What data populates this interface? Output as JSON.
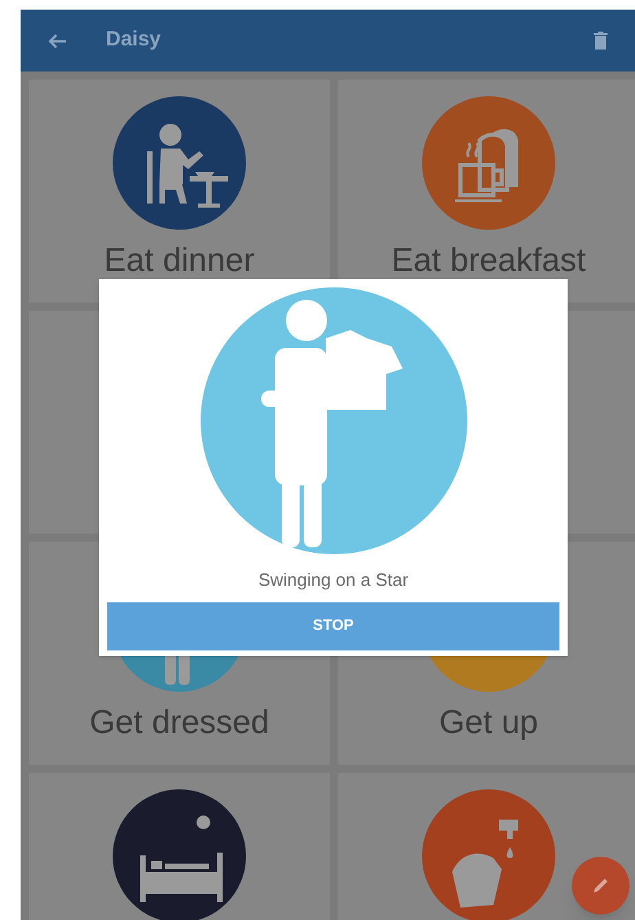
{
  "app_bar": {
    "title": "Daisy"
  },
  "tiles": [
    {
      "label": "Eat dinner",
      "color": "#1b3a63",
      "kind": "dining"
    },
    {
      "label": "Eat breakfast",
      "color": "#a14d1f",
      "kind": "breakfast"
    },
    {
      "kind": "blank"
    },
    {
      "kind": "blank"
    },
    {
      "label": "Get dressed",
      "color": "#3a8aa6",
      "kind": "dressing"
    },
    {
      "label": "Get up",
      "color": "#b07a20",
      "kind": "plain"
    },
    {
      "color": "#1a1c2e",
      "kind": "sleeping"
    },
    {
      "color": "#a4401d",
      "kind": "washing"
    }
  ],
  "dialog": {
    "title": "Swinging on a Star",
    "button": "STOP"
  }
}
